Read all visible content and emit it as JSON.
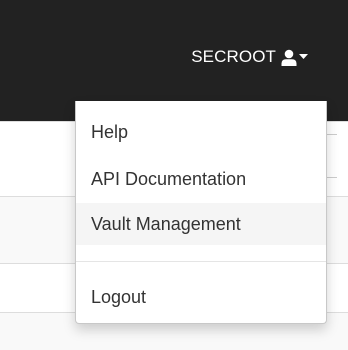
{
  "navbar": {
    "user_label": "SECROOT",
    "user_icon": "user-icon",
    "caret_icon": "caret-down-icon",
    "background": "#222222"
  },
  "dropdown": {
    "items": [
      {
        "label": "Help"
      },
      {
        "label": "API Documentation"
      },
      {
        "label": "Vault Management",
        "highlighted": true
      },
      {
        "label": "Logout"
      }
    ]
  }
}
